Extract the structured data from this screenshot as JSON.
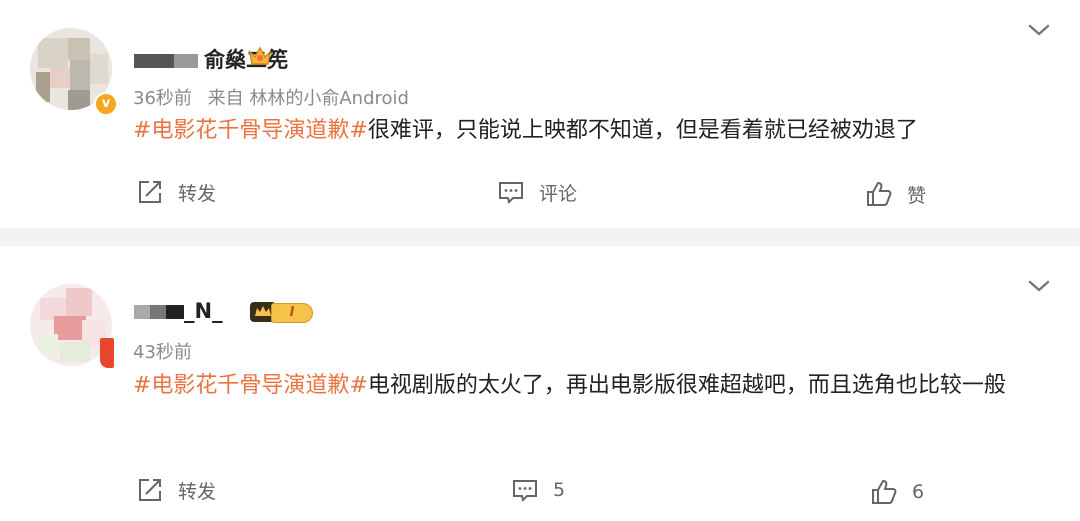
{
  "posts": [
    {
      "username": "俞燊二筅",
      "time": "36秒前",
      "source": "来自 林林的小俞Android",
      "topic": "#电影花千骨导演道歉#",
      "text": "很难评，只能说上映都不知道，但是看着就已经被劝退了",
      "actions": {
        "repost": "转发",
        "comment": "评论",
        "like": "赞"
      }
    },
    {
      "username": "_N_",
      "level_badge": "I",
      "time": "43秒前",
      "topic": "#电影花千骨导演道歉#",
      "text": "电视剧版的太火了，再出电影版很难超越吧，而且选角也比较一般",
      "actions": {
        "repost": "转发",
        "comment": "5",
        "like": "6"
      }
    }
  ],
  "colors": {
    "topic": "#eb7340",
    "meta": "#8a8a8a",
    "separator": "#f2f2f2",
    "badge_gold": "#f5a623"
  },
  "icons": [
    "chevron-down-icon",
    "repost-icon",
    "comment-icon",
    "like-icon",
    "verified-icon",
    "crown-badge-icon",
    "level-badge-icon"
  ]
}
